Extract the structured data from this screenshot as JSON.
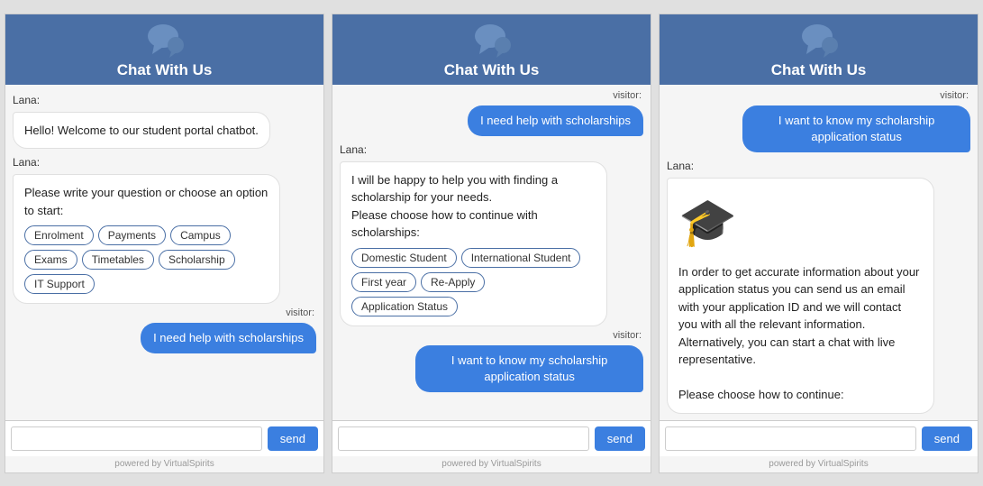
{
  "header": {
    "title": "Chat With Us",
    "powered_by": "powered by VirtualSpirits"
  },
  "widget1": {
    "messages": [
      {
        "type": "bot_label",
        "text": "Lana:"
      },
      {
        "type": "bot",
        "text": "Hello! Welcome to our student portal chatbot."
      },
      {
        "type": "bot_label2",
        "text": "Lana:"
      },
      {
        "type": "bot_options_msg",
        "text": "Please write your question or choose an option to start:"
      },
      {
        "type": "bot_options",
        "options": [
          "Enrolment",
          "Payments",
          "Campus",
          "Exams",
          "Timetables",
          "Scholarship",
          "IT Support"
        ]
      },
      {
        "type": "visitor_label",
        "text": "visitor:"
      },
      {
        "type": "visitor",
        "text": "I need help with scholarships"
      }
    ],
    "input_placeholder": "",
    "send_label": "send"
  },
  "widget2": {
    "messages": [
      {
        "type": "visitor_label",
        "text": "visitor:"
      },
      {
        "type": "visitor",
        "text": "I need help with scholarships"
      },
      {
        "type": "bot_label",
        "text": "Lana:"
      },
      {
        "type": "bot_options_msg",
        "text": "I will be happy to help you with finding a scholarship for your needs.\nPlease choose how to continue with scholarships:"
      },
      {
        "type": "bot_options",
        "options": [
          "Domestic Student",
          "International Student",
          "First year",
          "Re-Apply",
          "Application Status"
        ]
      },
      {
        "type": "visitor_label2",
        "text": "visitor:"
      },
      {
        "type": "visitor2",
        "text": "I want to know my scholarship application status"
      }
    ],
    "input_placeholder": "",
    "send_label": "send"
  },
  "widget3": {
    "messages": [
      {
        "type": "visitor_label",
        "text": "visitor:"
      },
      {
        "type": "visitor",
        "text": "I want to know my scholarship application status"
      },
      {
        "type": "bot_label",
        "text": "Lana:"
      },
      {
        "type": "bot_icon",
        "text": "🎓"
      },
      {
        "type": "bot_text",
        "text": "In order to get accurate information about your application status you can send us an email with your application ID and we will contact you with all the relevant information. Alternatively, you can start a chat with live representative."
      },
      {
        "type": "bot_continue",
        "text": "Please choose how to continue:"
      }
    ],
    "input_placeholder": "",
    "send_label": "send"
  }
}
